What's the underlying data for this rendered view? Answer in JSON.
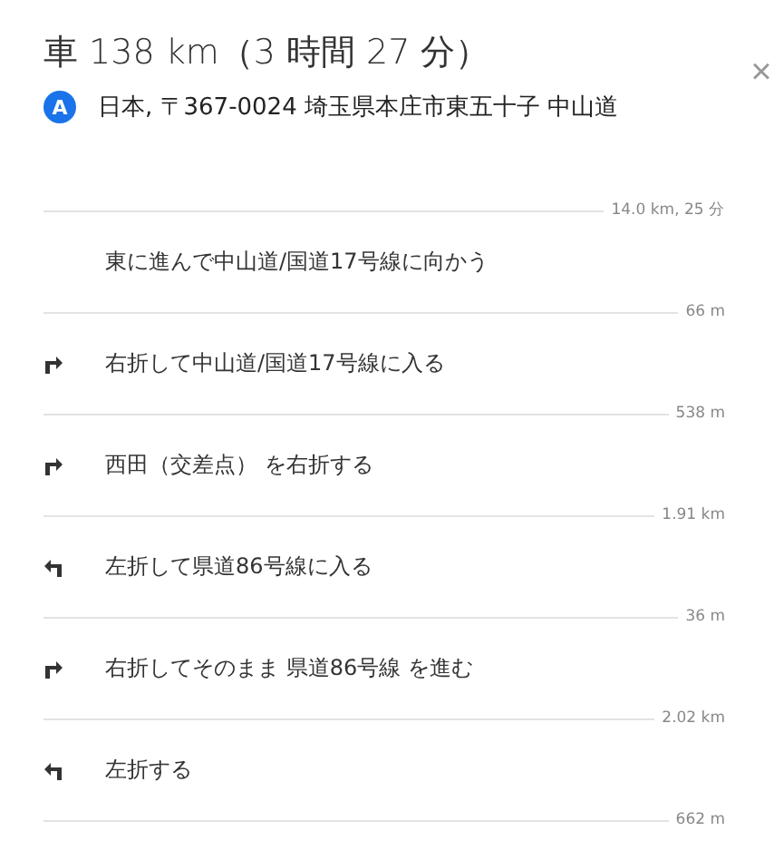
{
  "header": {
    "title": "車 138 km（3 時間 27 分）",
    "close": "×"
  },
  "start": {
    "marker": "A",
    "address": "日本, 〒367-0024 埼玉県本庄市東五十子 中山道",
    "distance": "14.0 km, 25 分"
  },
  "steps": [
    {
      "kind": "straight",
      "text": "東に進んで中山道/国道17号線に向かう",
      "distance": "66 m"
    },
    {
      "kind": "right",
      "text": "右折して中山道/国道17号線に入る",
      "distance": "538 m"
    },
    {
      "kind": "right",
      "text": "西田（交差点） を右折する",
      "distance": "1.91 km"
    },
    {
      "kind": "left",
      "text": "左折して県道86号線に入る",
      "distance": "36 m"
    },
    {
      "kind": "right",
      "text": "右折してそのまま 県道86号線 を進む",
      "distance": "2.02 km"
    },
    {
      "kind": "left",
      "text": "左折する",
      "distance": "662 m"
    }
  ]
}
